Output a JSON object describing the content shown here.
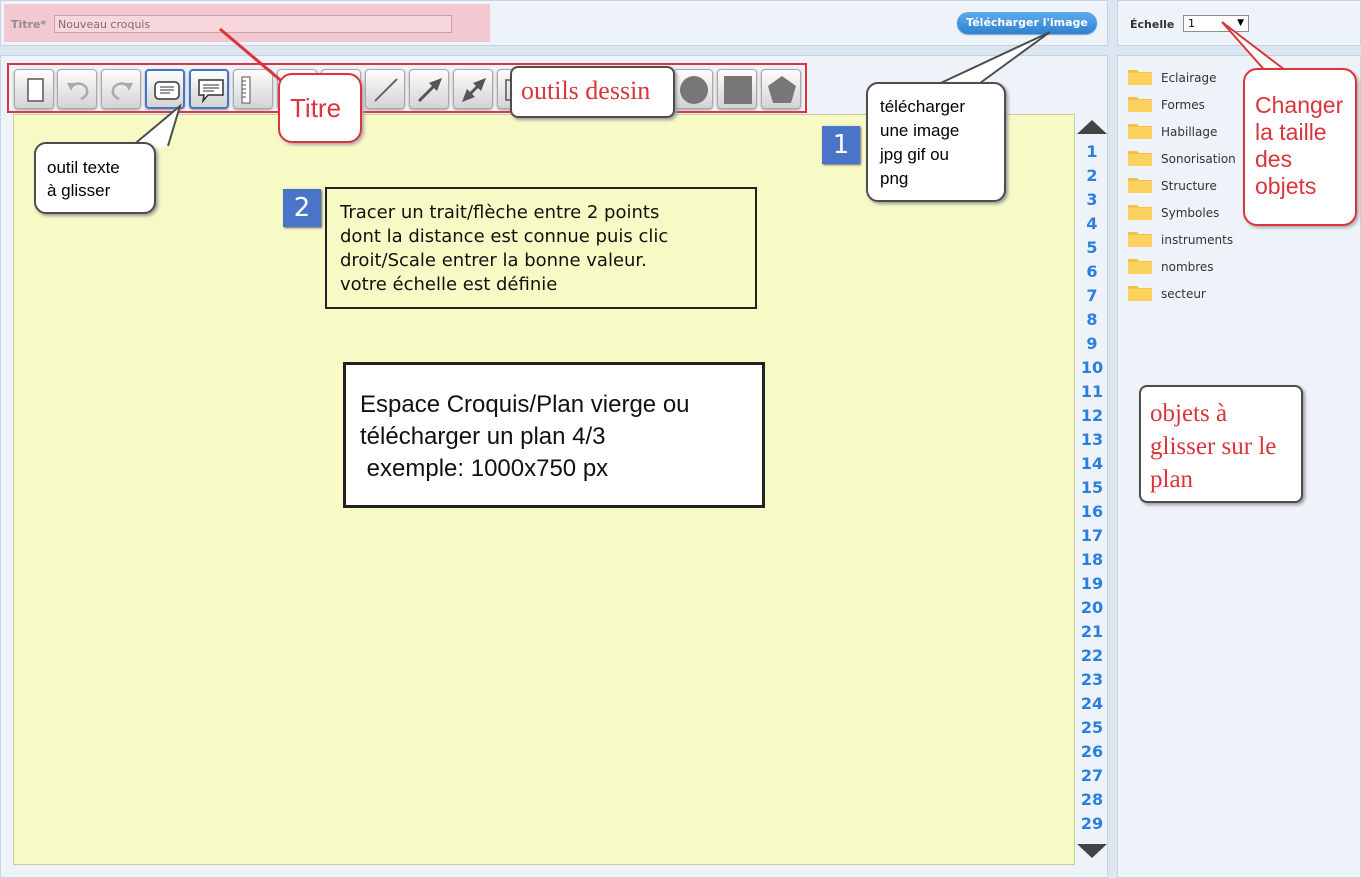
{
  "header": {
    "title_label": "Titre*",
    "title_value": "Nouveau croquis",
    "download_button": "Télécharger l'image"
  },
  "scale": {
    "label": "Échelle",
    "selected": "1"
  },
  "toolbar": {
    "tools": [
      "new-page",
      "undo",
      "redo",
      "text-box",
      "speech-bubble",
      "ruler",
      "rectangle-outline",
      "line",
      "line",
      "arrow",
      "double-arrow",
      "unknown",
      "unknown",
      "circle",
      "square",
      "pentagon"
    ]
  },
  "layers": [
    "1",
    "2",
    "3",
    "4",
    "5",
    "6",
    "7",
    "8",
    "9",
    "10",
    "11",
    "12",
    "13",
    "14",
    "15",
    "16",
    "17",
    "18",
    "19",
    "20",
    "21",
    "22",
    "23",
    "24",
    "25",
    "26",
    "27",
    "28",
    "29"
  ],
  "folders": [
    "Eclairage",
    "Formes",
    "Habillage",
    "Sonorisation",
    "Structure",
    "Symboles",
    "instruments",
    "nombres",
    "secteur"
  ],
  "annotations": {
    "titre": "Titre",
    "outils_dessin": "outils dessin",
    "outil_texte": "outil texte\nà glisser",
    "telecharger": "télécharger\nune image\njpg gif ou\npng",
    "changer_taille": "Changer\nla taille\ndes\nobjets",
    "objets_glisser": "objets à\nglisser sur le\nplan",
    "badge1": "1",
    "badge2": "2",
    "step2_text": "Tracer un trait/flèche entre 2 points\ndont la distance est connue puis clic\ndroit/Scale entrer la bonne valeur.\nvotre échelle est définie",
    "canvas_text": "Espace Croquis/Plan vierge ou\ntélécharger un plan 4/3\n exemple: 1000x750 px"
  },
  "colors": {
    "accent_blue": "#2c7fdd",
    "annotation_red": "#d9353b",
    "canvas": "#f7fac5",
    "badge": "#4a74c7"
  }
}
